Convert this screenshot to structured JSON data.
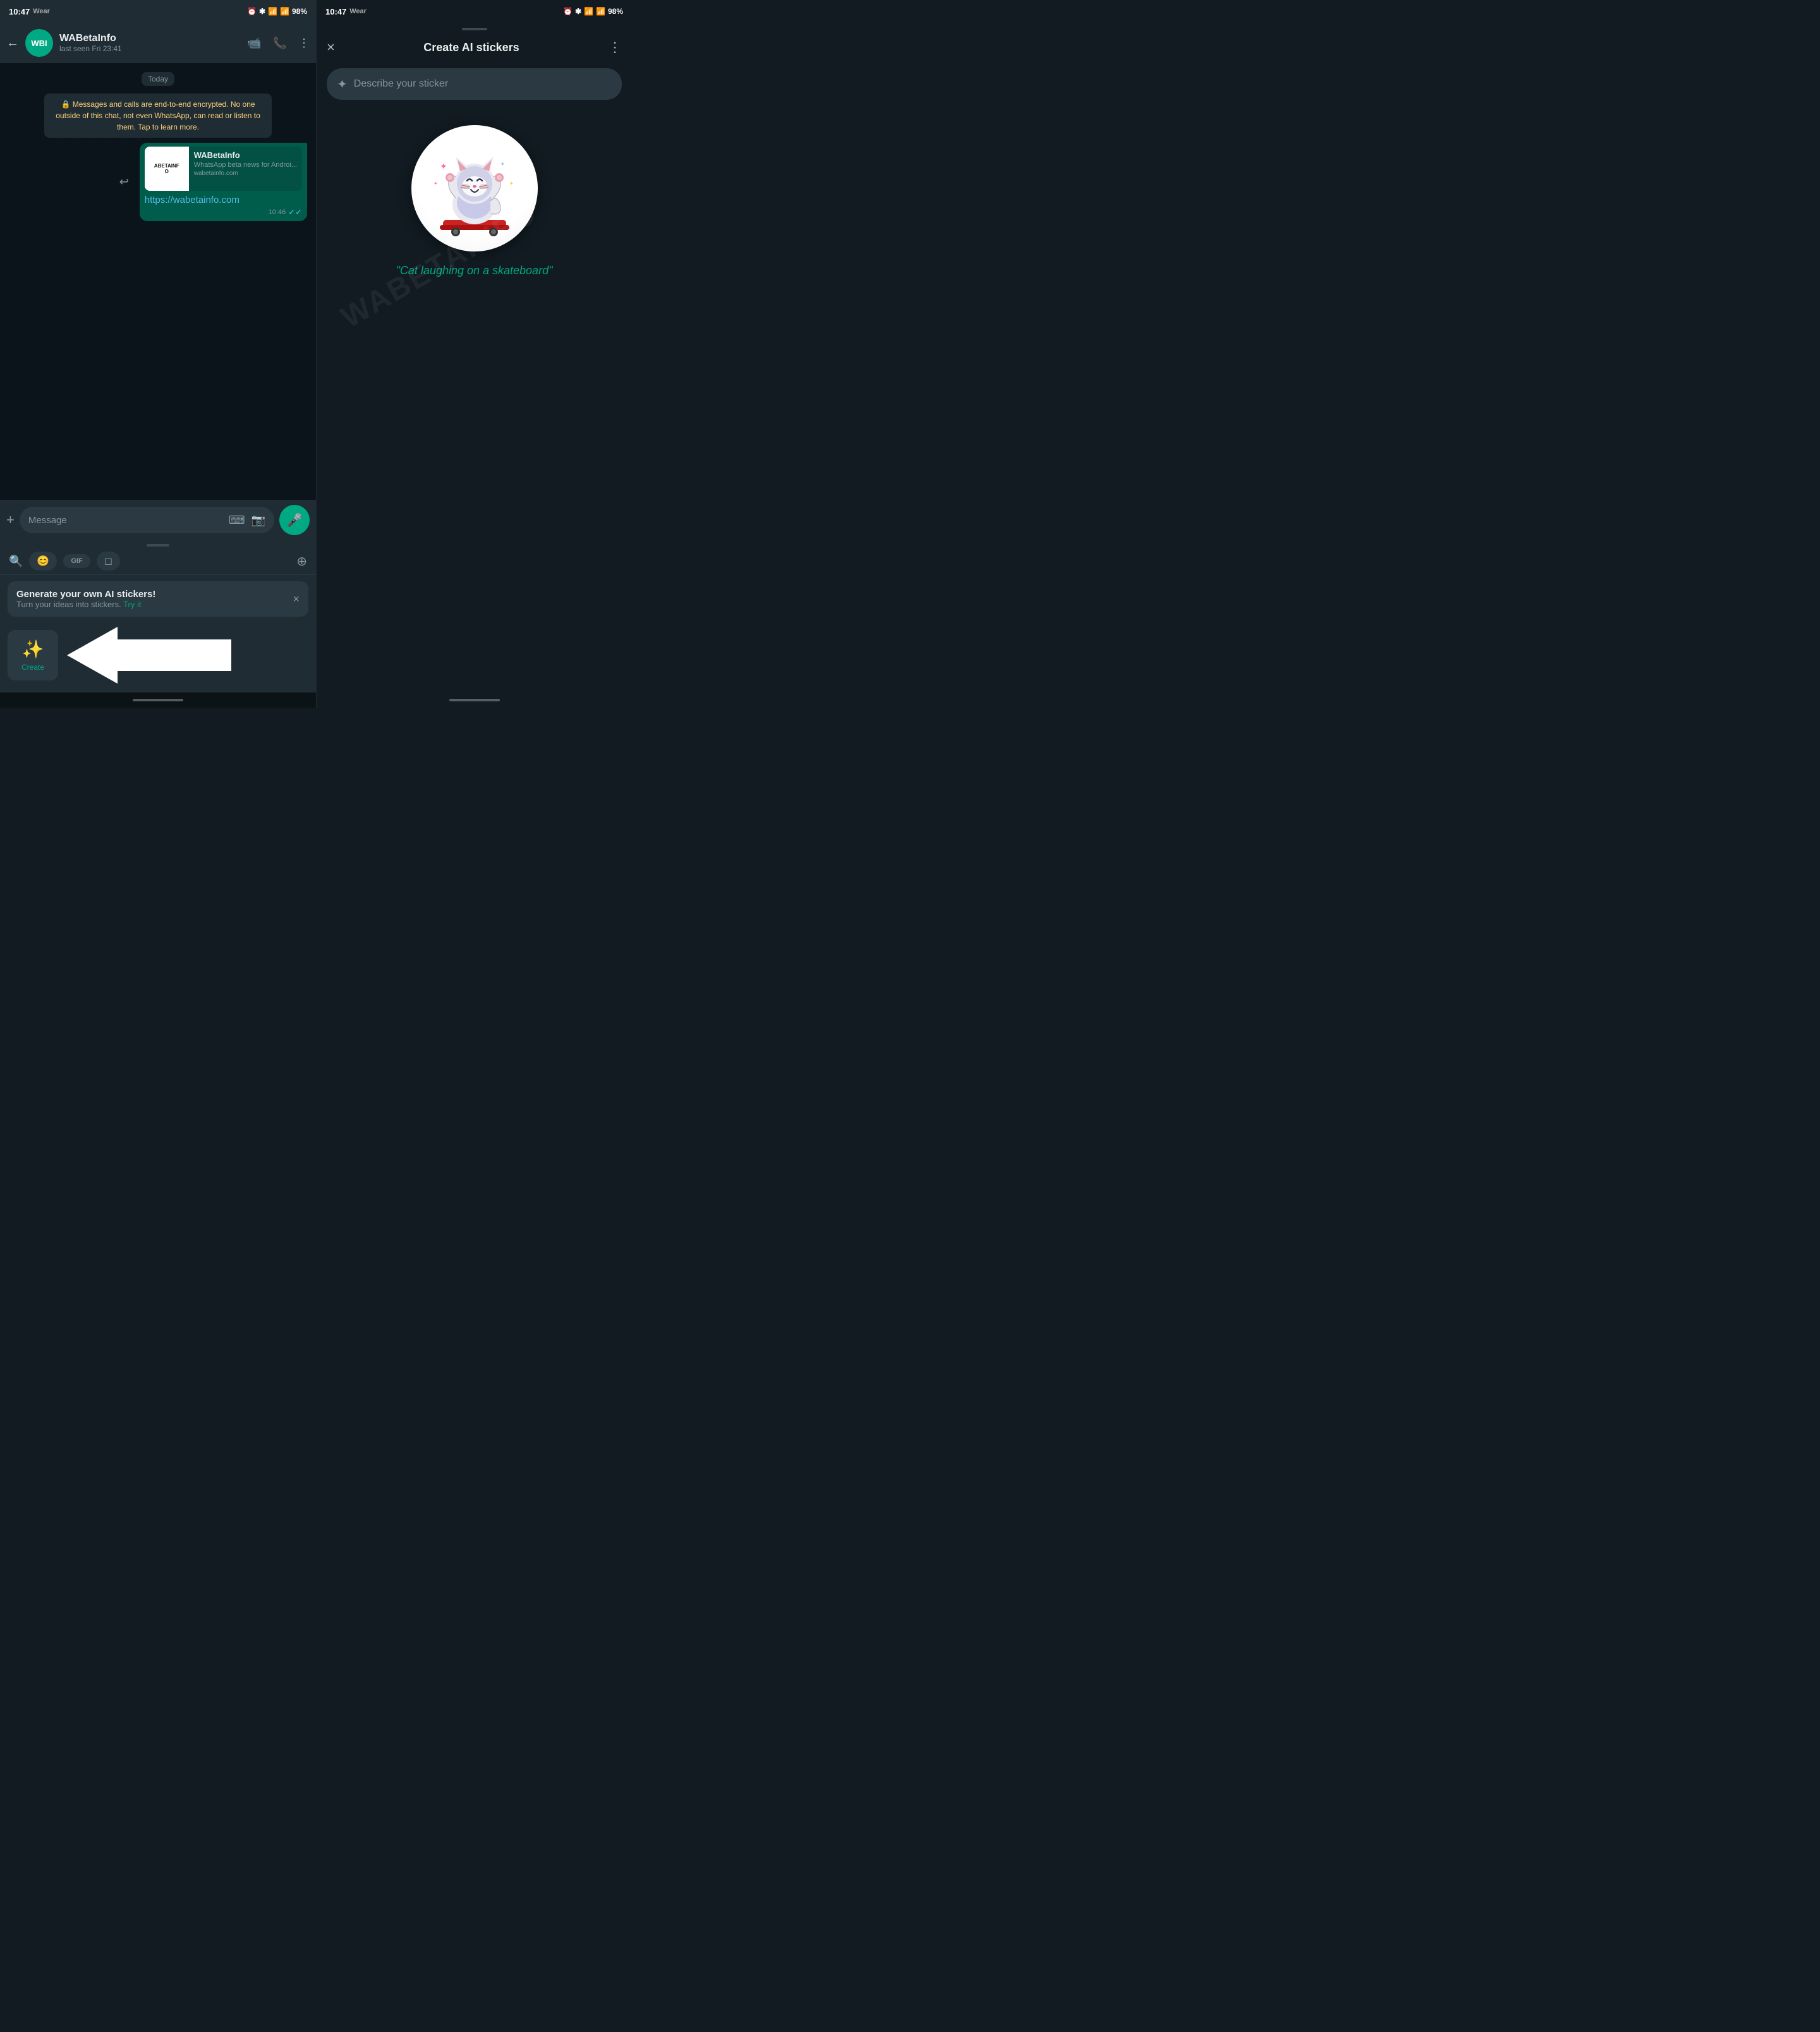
{
  "left": {
    "statusBar": {
      "time": "10:47",
      "wear": "Wear",
      "battery": "98%"
    },
    "header": {
      "backLabel": "←",
      "avatarText": "WBI",
      "name": "WABetaInfo",
      "status": "last seen Fri 23:41",
      "icons": [
        "📹",
        "📞",
        "⋮"
      ]
    },
    "chat": {
      "dateBadge": "Today",
      "systemMsg": "🔒 Messages and calls are end-to-end encrypted. No one outside of this chat, not even WhatsApp, can read or listen to them. Tap to learn more.",
      "bubble": {
        "previewTitle": "WABetaInfo",
        "previewDesc": "WhatsApp beta news for Androi...",
        "previewUrl": "wabetainfo.com",
        "previewThumb": "ABETAINF",
        "link": "https://wabetainfo.com",
        "time": "10:46",
        "tick": "✓✓"
      }
    },
    "input": {
      "plusIcon": "+",
      "placeholder": "Message",
      "keyboardIcon": "⌨",
      "cameraIcon": "📷",
      "micIcon": "🎤"
    },
    "stickerPanel": {
      "tabs": [
        "😊",
        "GIF",
        "◻",
        "+"
      ],
      "banner": {
        "title": "Generate your own AI stickers!",
        "subtitle": "Turn your ideas into stickers.",
        "tryLabel": "Try it",
        "closeIcon": "×"
      },
      "createBtn": {
        "icon": "✨",
        "label": "Create"
      },
      "arrowLabel": "←"
    }
  },
  "right": {
    "statusBar": {
      "time": "10:47",
      "wear": "Wear",
      "battery": "98%"
    },
    "sheetTitle": "Create AI stickers",
    "moreIcon": "⋮",
    "closeIcon": "×",
    "searchPlaceholder": "Describe your sticker",
    "sparkleIcon": "✦",
    "stickerCaption": "\"Cat laughing on a skateboard\""
  }
}
